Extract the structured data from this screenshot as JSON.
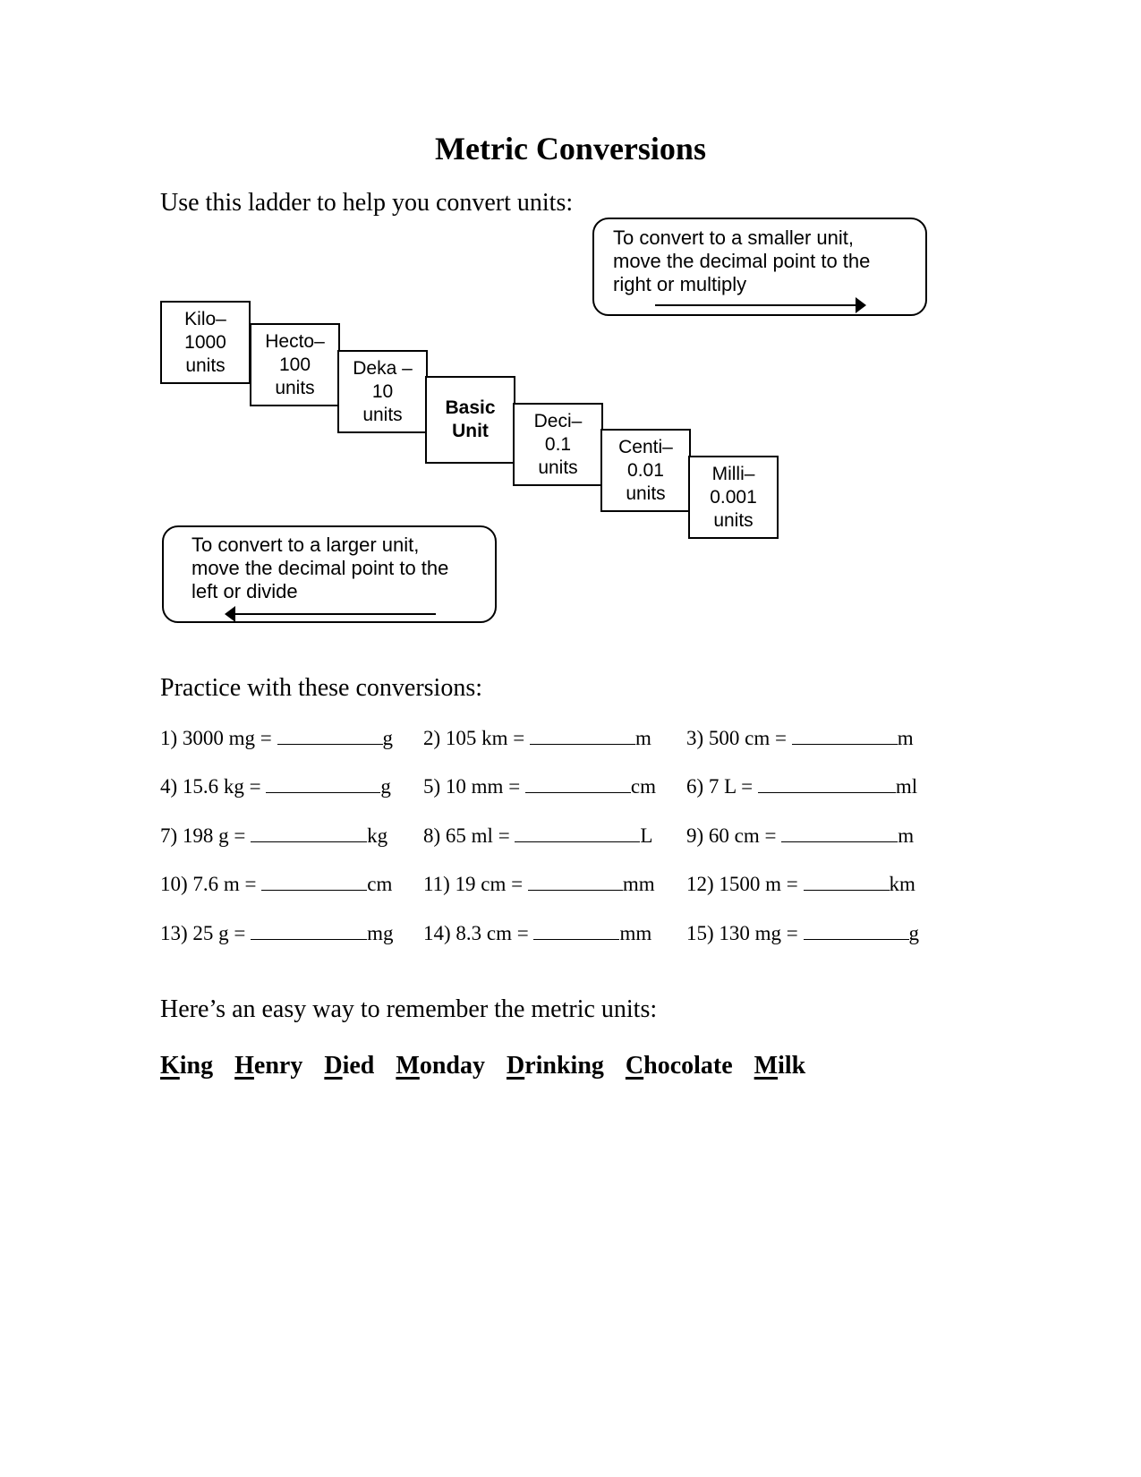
{
  "document": {
    "title": "Metric Conversions",
    "intro": "Use this ladder to help you convert units:",
    "callouts": {
      "smaller": {
        "lines": [
          "To convert to a smaller unit,",
          "move the decimal point to the",
          "right or multiply"
        ],
        "arrow_direction": "right"
      },
      "larger": {
        "lines": [
          "To convert to a larger unit,",
          "move the decimal point to the",
          "left or divide"
        ],
        "arrow_direction": "left"
      }
    },
    "ladder": [
      {
        "lines": [
          "Kilo–",
          "1000",
          "units"
        ],
        "bold": false
      },
      {
        "lines": [
          "Hecto–",
          "100",
          "units"
        ],
        "bold": false
      },
      {
        "lines": [
          "Deka –",
          "10",
          "units"
        ],
        "bold": false
      },
      {
        "lines": [
          "Basic",
          "Unit"
        ],
        "bold": true
      },
      {
        "lines": [
          "Deci–",
          "0.1",
          "units"
        ],
        "bold": false
      },
      {
        "lines": [
          "Centi–",
          "0.01",
          "units"
        ],
        "bold": false
      },
      {
        "lines": [
          "Milli–",
          "0.001",
          "units"
        ],
        "bold": false
      }
    ],
    "practice_heading": "Practice with these conversions:",
    "problems": [
      {
        "prompt": "1) 3000 mg = ",
        "unit": "g"
      },
      {
        "prompt": "2) 105 km = ",
        "unit": "m"
      },
      {
        "prompt": "3) 500 cm = ",
        "unit": "m"
      },
      {
        "prompt": "4) 15.6 kg = ",
        "unit": "g"
      },
      {
        "prompt": "5) 10 mm = ",
        "unit": "cm"
      },
      {
        "prompt": "6) 7 L = ",
        "unit": "ml"
      },
      {
        "prompt": "7) 198 g = ",
        "unit": "kg"
      },
      {
        "prompt": "8) 65 ml = ",
        "unit": "L"
      },
      {
        "prompt": "9) 60 cm = ",
        "unit": "m"
      },
      {
        "prompt": "10) 7.6 m = ",
        "unit": "cm"
      },
      {
        "prompt": "11) 19 cm = ",
        "unit": "mm"
      },
      {
        "prompt": "12) 1500 m = ",
        "unit": "km"
      },
      {
        "prompt": "13) 25 g = ",
        "unit": "mg"
      },
      {
        "prompt": "14) 8.3 cm = ",
        "unit": "mm"
      },
      {
        "prompt": "15) 130 mg = ",
        "unit": "g"
      }
    ],
    "remember_heading": "Here’s an easy way to remember the metric units:",
    "mnemonic": [
      {
        "first": "K",
        "rest": "ing"
      },
      {
        "first": "H",
        "rest": "enry"
      },
      {
        "first": "D",
        "rest": "ied"
      },
      {
        "first": "M",
        "rest": "onday"
      },
      {
        "first": "D",
        "rest": "rinking"
      },
      {
        "first": "C",
        "rest": "hocolate"
      },
      {
        "first": "M",
        "rest": "ilk"
      }
    ]
  }
}
